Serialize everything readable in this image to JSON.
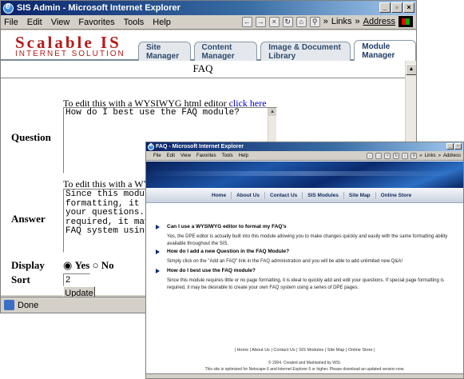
{
  "back_window": {
    "title": "SIS Admin - Microsoft Internet Explorer",
    "menu": [
      "File",
      "Edit",
      "View",
      "Favorites",
      "Tools",
      "Help"
    ],
    "toolbar": {
      "links_label": "Links",
      "address_label": "Address"
    },
    "logo": {
      "main": "Scalable IS",
      "sub": "INTERNET SOLUTION"
    },
    "tabs": [
      "Site Manager",
      "Content Manager",
      "Image & Document Library",
      "Module Manager"
    ],
    "active_tab": "Module Manager",
    "page_heading": "FAQ",
    "editor_prompt": "To edit this with a WYSIWYG html editor",
    "editor_link": "click here",
    "question_label": "Question",
    "question_value": "How do I best use the FAQ module?",
    "editor_prompt_2": "To edit this with a WYSIW",
    "answer_label": "Answer",
    "answer_value": "Since this module re\nformatting, it is id\nyour questions. If s\nrequired, it may be\nFAQ system using a s",
    "display_label": "Display",
    "display_options": [
      "Yes",
      "No"
    ],
    "display_selected": "Yes",
    "sort_label": "Sort",
    "sort_value": "2",
    "update_button": "Update",
    "status": "Done"
  },
  "front_window": {
    "title": "FAQ - Microsoft Internet Explorer",
    "menu": [
      "File",
      "Edit",
      "View",
      "Favorites",
      "Tools",
      "Help"
    ],
    "toolbar": {
      "links_label": "Links",
      "address_label": "Address"
    },
    "nav": [
      "Home",
      "About Us",
      "Contact Us",
      "SIS Modules",
      "Site Map",
      "Online Store"
    ],
    "faqs": [
      {
        "q": "Can I use a WYSIWYG editor to format my FAQ's",
        "a": "Yes, the DPE editor is actually built into this module allowing you to make changes quickly and easily with the same formatting ability available throughout the SIS."
      },
      {
        "q": "How do I add a new Question in the FAQ Module?",
        "a": "Simply click on the \"Add an FAQ\" link in the FAQ administration and you will be able to add unlimited new Q&A!"
      },
      {
        "q": "How do I best use the FAQ module?",
        "a": "Since this module requires little or no page formatting, it is ideal to quickly add and edit your questions. If special page formatting is required, it may be desirable to create your own FAQ system using a series of DPE pages."
      }
    ],
    "footer_links": "| Home | About Us | Contact Us | SIS Modules | Site Map | Online Store |",
    "footer_copy": "© 2004. Created and Maintained by WSI.",
    "footer_optimized": "This site is optimized for Netscape 6 and Internet Explorer 6 or higher. Please download an updated version now."
  }
}
